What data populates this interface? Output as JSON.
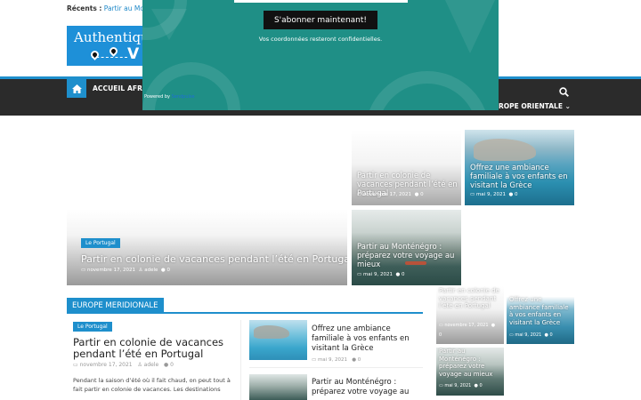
{
  "topbar": {
    "recents_label": "Récents :",
    "recents_link": "Partir au Monté"
  },
  "logo": {
    "text": "Authentiqu",
    "text2": "V"
  },
  "nav": {
    "home_label": "home",
    "items": [
      "ACCUEIL",
      "AFRI"
    ],
    "item_right": "ROPE ORIENTALE"
  },
  "popup": {
    "button": "S'abonner maintenant!",
    "note": "Vos coordonnées resteront confidentielles.",
    "powered_prefix": "Powered by",
    "powered_brand": "Sendpulse"
  },
  "featured": {
    "main": {
      "tag": "Le Portugal",
      "title": "Partir en colonie de vacances pendant l’été en Portugal",
      "date": "novembre 17, 2021",
      "author": "adele",
      "comments": "0"
    },
    "top_mid": {
      "title": "Partir en colonie de vacances pendant l’été en Portugal",
      "date": "novembre 17, 2021",
      "comments": "0"
    },
    "top_right": {
      "title": "Offrez une ambiance familiale à vos enfants en visitant la Grèce",
      "date": "mai 9, 2021",
      "comments": "0"
    },
    "bottom_mid": {
      "title": "Partir au Monténégro : préparez votre voyage au mieux",
      "date": "mai 9, 2021",
      "comments": "0"
    }
  },
  "section": {
    "title": "EUROPE MERIDIONALE",
    "main_post": {
      "tag": "Le Portugal",
      "title": "Partir en colonie de vacances pendant l’été en Portugal",
      "date": "novembre 17, 2021",
      "author": "adele",
      "comments": "0",
      "excerpt": "Pendant la saison d’été où il fait chaud, on peut tout à fait partir en colonie de vacances. Les destinations"
    },
    "side_posts": [
      {
        "title": "Offrez une ambiance familiale à vos enfants en visitant la Grèce",
        "date": "mai 9, 2021",
        "comments": "0"
      },
      {
        "title": "Partir au Monténégro : préparez votre voyage au"
      }
    ]
  },
  "mini_grid": [
    {
      "title": "Partir en colonie de vacances pendant l’été en Portugal",
      "date": "novembre 17, 2021",
      "comments": "0"
    },
    {
      "title": "Offrez une ambiance familiale à vos enfants en visitant la Grèce",
      "date": "mai 9, 2021",
      "comments": "0"
    },
    {
      "title": "Partir au Monténégro : préparez votre voyage au mieux",
      "date": "mai 9, 2021",
      "comments": "0"
    }
  ],
  "colors": {
    "accent": "#1e8fcc",
    "popup": "#1f8f86",
    "nav": "#2b2b2b"
  }
}
